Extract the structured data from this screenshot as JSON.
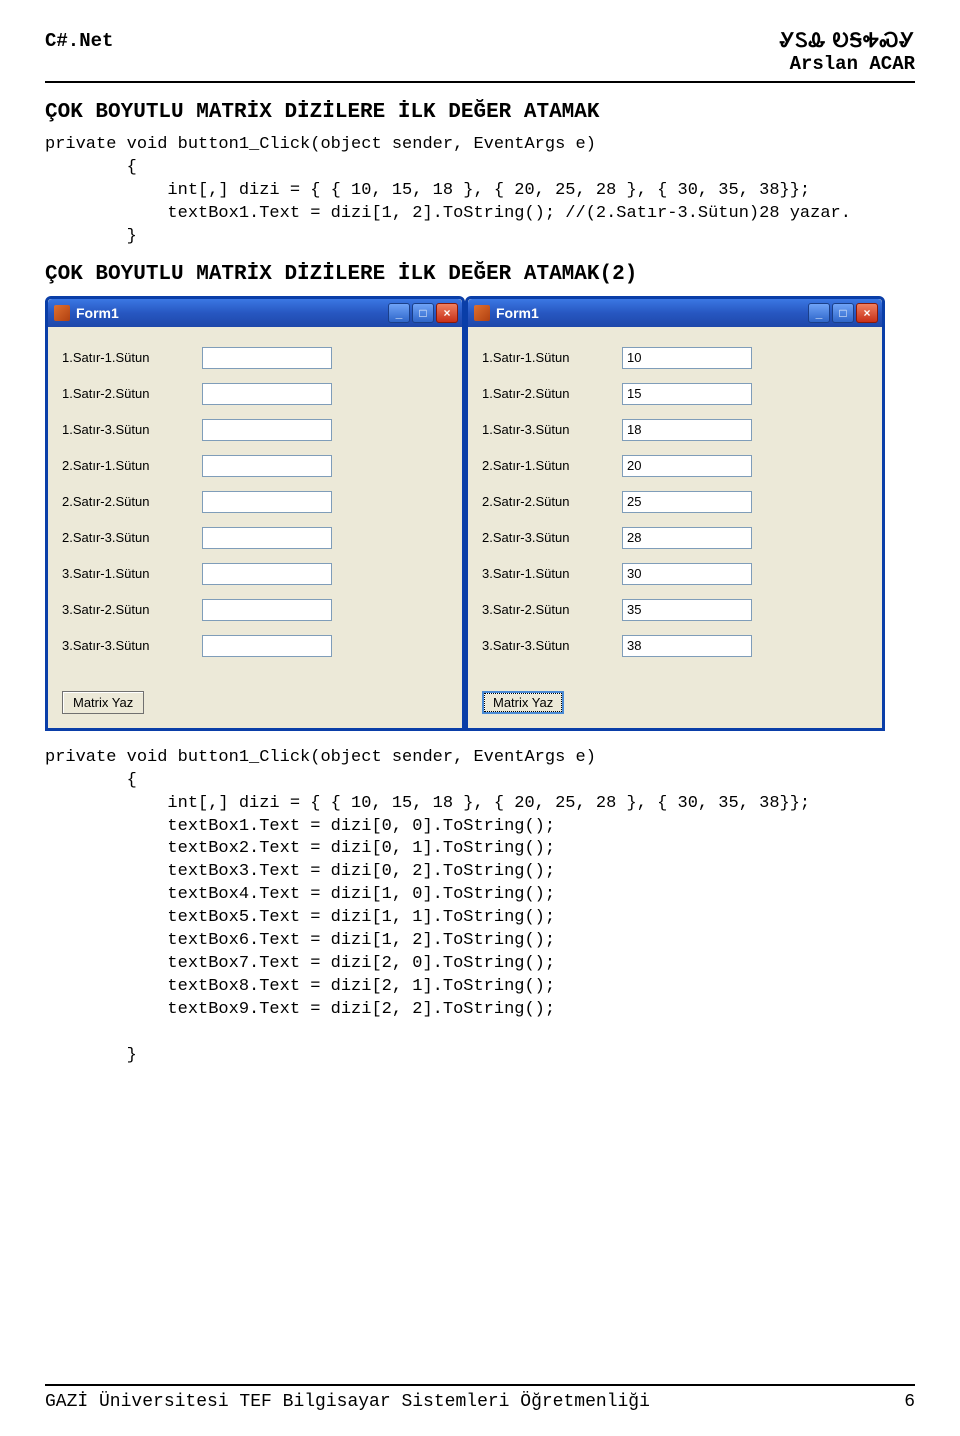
{
  "header": {
    "left": "C#.Net",
    "right_fancy": "ᎽᏚᎲ  ᎧᎦᎭᏍᎽ",
    "right_name": "Arslan ACAR"
  },
  "title1": "ÇOK BOYUTLU MATRİX DİZİLERE İLK DEĞER ATAMAK",
  "code1_lines": [
    "private void button1_Click(object sender, EventArgs e)",
    "        {",
    "            int[,] dizi = { { 10, 15, 18 }, { 20, 25, 28 }, { 30, 35, 38}};",
    "            textBox1.Text = dizi[1, 2].ToString(); //(2.Satır-3.Sütun)28 yazar.",
    "        }"
  ],
  "title2": "ÇOK BOYUTLU MATRİX DİZİLERE İLK DEĞER ATAMAK(2)",
  "form_common": {
    "window_title": "Form1",
    "labels": [
      "1.Satır-1.Sütun",
      "1.Satır-2.Sütun",
      "1.Satır-3.Sütun",
      "2.Satır-1.Sütun",
      "2.Satır-2.Sütun",
      "2.Satır-3.Sütun",
      "3.Satır-1.Sütun",
      "3.Satır-2.Sütun",
      "3.Satır-3.Sütun"
    ],
    "button_label": "Matrix Yaz"
  },
  "form_left": {
    "values": [
      "",
      "",
      "",
      "",
      "",
      "",
      "",
      "",
      ""
    ]
  },
  "form_right": {
    "values": [
      "10",
      "15",
      "18",
      "20",
      "25",
      "28",
      "30",
      "35",
      "38"
    ]
  },
  "code2_lines": [
    "private void button1_Click(object sender, EventArgs e)",
    "        {",
    "            int[,] dizi = { { 10, 15, 18 }, { 20, 25, 28 }, { 30, 35, 38}};",
    "            textBox1.Text = dizi[0, 0].ToString();",
    "            textBox2.Text = dizi[0, 1].ToString();",
    "            textBox3.Text = dizi[0, 2].ToString();",
    "            textBox4.Text = dizi[1, 0].ToString();",
    "            textBox5.Text = dizi[1, 1].ToString();",
    "            textBox6.Text = dizi[1, 2].ToString();",
    "            textBox7.Text = dizi[2, 0].ToString();",
    "            textBox8.Text = dizi[2, 1].ToString();",
    "            textBox9.Text = dizi[2, 2].ToString();",
    "",
    "        }"
  ],
  "footer": {
    "text": "GAZİ Üniversitesi TEF Bilgisayar Sistemleri Öğretmenliği",
    "page": "6"
  }
}
